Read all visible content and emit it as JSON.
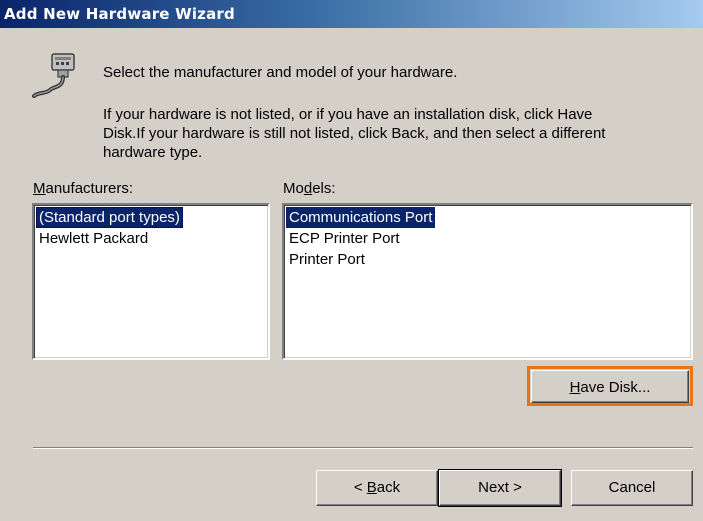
{
  "window": {
    "title": "Add New Hardware Wizard"
  },
  "icon": "serial-port-cable-icon",
  "instructions": {
    "line1": "Select the manufacturer and model of your hardware.",
    "line2a": "If your hardware is not listed, or if you have an installation disk, click Have",
    "line2b": "Disk.If your hardware is still not listed, click Back, and then select a different",
    "line2c": "hardware type."
  },
  "manufacturers": {
    "label_prefix": "",
    "label_accel": "M",
    "label_rest": "anufacturers:",
    "items": [
      "(Standard port types)",
      "Hewlett Packard"
    ],
    "selected": "(Standard port types)"
  },
  "models": {
    "label_prefix": "Mo",
    "label_accel": "d",
    "label_rest": "els:",
    "items": [
      "Communications Port",
      "ECP Printer Port",
      "Printer Port"
    ],
    "selected": "Communications Port"
  },
  "buttons": {
    "have_disk_accel": "H",
    "have_disk_rest": "ave Disk...",
    "back_prefix": "< ",
    "back_accel": "B",
    "back_rest": "ack",
    "next": "Next >",
    "cancel": "Cancel"
  },
  "colors": {
    "selection": "#0a246a",
    "highlight_box": "#e8741a",
    "face": "#d4d0c8"
  }
}
